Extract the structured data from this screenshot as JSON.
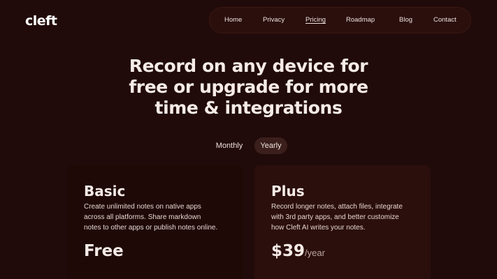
{
  "brand": {
    "logo": "cleft"
  },
  "nav": {
    "items": [
      {
        "label": "Home"
      },
      {
        "label": "Privacy"
      },
      {
        "label": "Pricing",
        "active": true
      },
      {
        "label": "Roadmap"
      },
      {
        "label": "Blog"
      },
      {
        "label": "Contact"
      }
    ]
  },
  "hero": {
    "lines": [
      "Record on any device for",
      "free or upgrade for more",
      "time & integrations"
    ]
  },
  "billing_toggle": {
    "options": [
      "Monthly",
      "Yearly"
    ],
    "selected": "Yearly"
  },
  "plans": [
    {
      "name": "Basic",
      "description_lines": [
        "Create unlimited notes on native apps",
        "across all platforms. Share markdown",
        "notes to other apps or publish notes online."
      ],
      "price": "Free",
      "period": ""
    },
    {
      "name": "Plus",
      "description_lines": [
        "Record longer notes, attach files, integrate",
        "with 3rd party apps, and better customize",
        "how Cleft AI writes your notes."
      ],
      "price": "$39",
      "period": "/year"
    }
  ],
  "colors": {
    "background": "#210b0a",
    "card_basic": "#1e0907",
    "card_plus": "#2b0f0c",
    "accent": "#c45a4f",
    "text": "#f6ebe6"
  }
}
